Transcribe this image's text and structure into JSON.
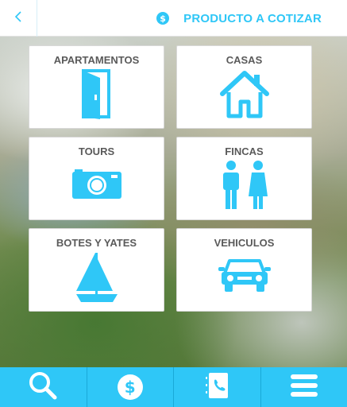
{
  "header": {
    "back_icon": "chevron-left-icon",
    "currency_icon_glyph": "$",
    "title": "PRODUCTO A COTIZAR"
  },
  "categories": [
    {
      "label": "APARTAMENTOS",
      "icon": "door-icon"
    },
    {
      "label": "CASAS",
      "icon": "house-icon"
    },
    {
      "label": "TOURS",
      "icon": "camera-icon"
    },
    {
      "label": "FINCAS",
      "icon": "people-icon"
    },
    {
      "label": "BOTES Y YATES",
      "icon": "sailboat-icon"
    },
    {
      "label": "VEHICULOS",
      "icon": "car-icon"
    }
  ],
  "tabbar": {
    "tabs": [
      {
        "icon": "search-icon"
      },
      {
        "icon": "dollar-icon",
        "glyph": "$"
      },
      {
        "icon": "contacts-book-icon"
      },
      {
        "icon": "menu-icon"
      }
    ]
  },
  "colors": {
    "accent": "#2fc7f7",
    "label_text": "#5a5a5a",
    "card_bg": "#ffffff"
  }
}
